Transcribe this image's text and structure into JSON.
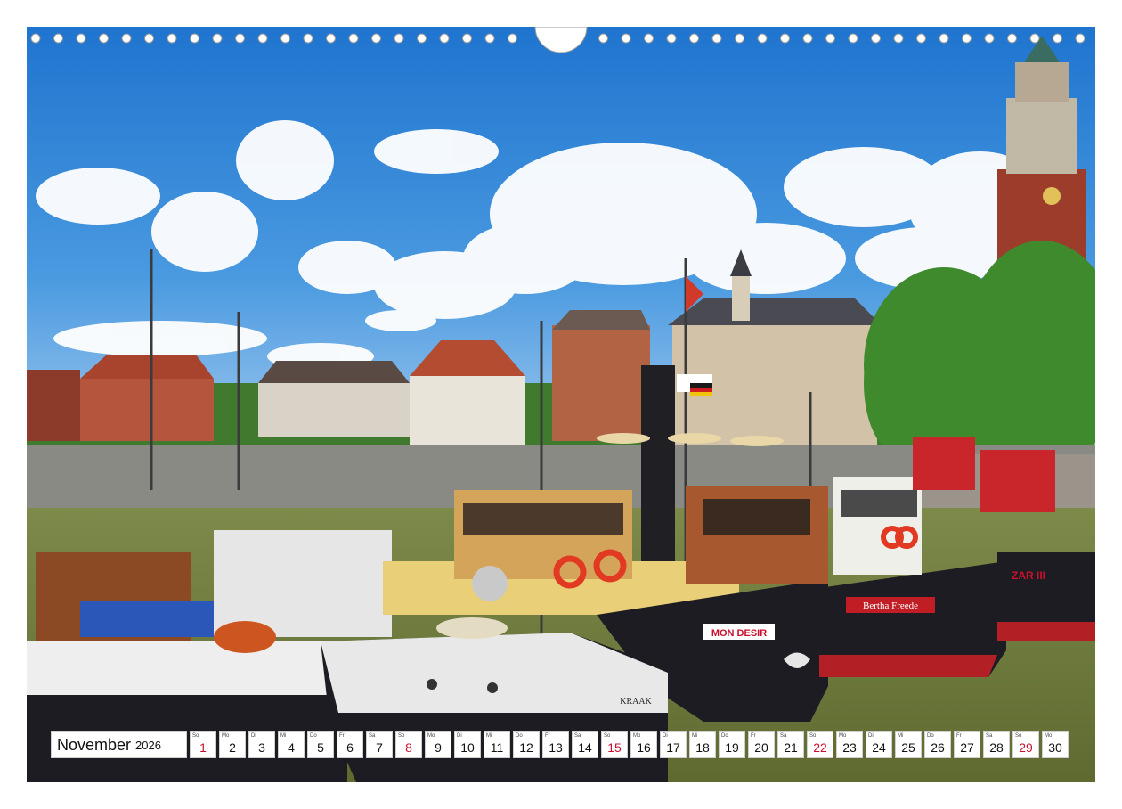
{
  "calendar": {
    "month": "November",
    "year": "2026",
    "days": [
      {
        "num": "1",
        "wd": "So",
        "sunday": true
      },
      {
        "num": "2",
        "wd": "Mo"
      },
      {
        "num": "3",
        "wd": "Di"
      },
      {
        "num": "4",
        "wd": "Mi"
      },
      {
        "num": "5",
        "wd": "Do"
      },
      {
        "num": "6",
        "wd": "Fr"
      },
      {
        "num": "7",
        "wd": "Sa"
      },
      {
        "num": "8",
        "wd": "So",
        "sunday": true
      },
      {
        "num": "9",
        "wd": "Mo"
      },
      {
        "num": "10",
        "wd": "Di"
      },
      {
        "num": "11",
        "wd": "Mi"
      },
      {
        "num": "12",
        "wd": "Do"
      },
      {
        "num": "13",
        "wd": "Fr"
      },
      {
        "num": "14",
        "wd": "Sa"
      },
      {
        "num": "15",
        "wd": "So",
        "sunday": true
      },
      {
        "num": "16",
        "wd": "Mo"
      },
      {
        "num": "17",
        "wd": "Di"
      },
      {
        "num": "18",
        "wd": "Mi"
      },
      {
        "num": "19",
        "wd": "Do"
      },
      {
        "num": "20",
        "wd": "Fr"
      },
      {
        "num": "21",
        "wd": "Sa"
      },
      {
        "num": "22",
        "wd": "So",
        "sunday": true
      },
      {
        "num": "23",
        "wd": "Mo"
      },
      {
        "num": "24",
        "wd": "Di"
      },
      {
        "num": "25",
        "wd": "Mi"
      },
      {
        "num": "26",
        "wd": "Do"
      },
      {
        "num": "27",
        "wd": "Fr"
      },
      {
        "num": "28",
        "wd": "Sa"
      },
      {
        "num": "29",
        "wd": "So",
        "sunday": true
      },
      {
        "num": "30",
        "wd": "Mo"
      }
    ]
  },
  "photo": {
    "boat_names": [
      "MON DESIR",
      "Bertha Freede",
      "KRAAK",
      "ZAR III"
    ]
  },
  "colors": {
    "sunday": "#c8102e",
    "sky": "#2f86d8",
    "water": "#6d7a3c",
    "hull_dark": "#1c1c22",
    "roof_red": "#a8432e"
  }
}
